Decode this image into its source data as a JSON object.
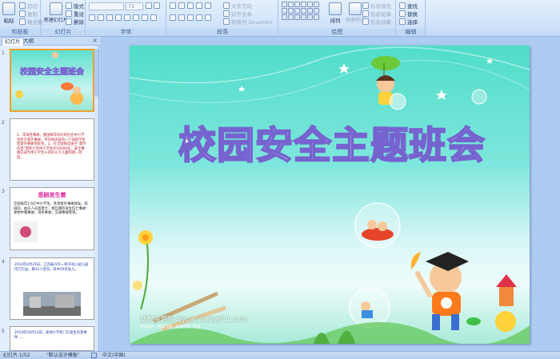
{
  "ribbon": {
    "clipboard": {
      "label": "剪贴板",
      "paste": "粘贴",
      "cut": "剪切",
      "copy": "复制",
      "format_painter": "格式刷"
    },
    "slides": {
      "label": "幻灯片",
      "new_slide": "新建幻灯片",
      "layout": "版式",
      "reset": "重设",
      "delete": "删除"
    },
    "font": {
      "label": "字体",
      "font_size": "72"
    },
    "paragraph": {
      "label": "段落",
      "text_direction": "文字方向",
      "align_text": "对齐文本",
      "smartart": "转换为 SmartArt"
    },
    "drawing": {
      "label": "绘图",
      "arrange": "排列",
      "quick_styles": "快速样式",
      "shape_fill": "形状填充",
      "shape_outline": "形状轮廓",
      "shape_effects": "形状效果"
    },
    "editing": {
      "label": "编辑",
      "find": "查找",
      "replace": "替换",
      "select": "选择"
    }
  },
  "pane": {
    "tab_slides": "幻灯片",
    "tab_outline": "大纲",
    "close": "×",
    "thumbs": [
      {
        "num": "1",
        "title": "校园安全主题班会"
      },
      {
        "num": "2",
        "text": "1、常发性事故，我国每年有约四百名中小学生死于意外事故，平均每天就有一个班的学生因意外事故而丧生。2、在全国每年由于“意外伤害”而死亡的中小学生约16000名，安全事故已成为中小学生十四岁以下儿童的第一死因。"
      },
      {
        "num": "3",
        "title": "悲剧发生着",
        "text": "全国每年1.6亿中小学生，各项意外事故频发。校园内，由于人员密度大，相互拥挤发生伤亡事故：食物中毒事故；溺水事故；交通事故等等。"
      },
      {
        "num": "4",
        "text": "2010年4月29日，江苏泰兴市一男子闯入幼儿园持刀行凶，致32人受伤，其中29名幼儿。"
      },
      {
        "num": "5",
        "text": "2010年04月23日，某地小学校门口发生伤害事件……"
      }
    ]
  },
  "slide": {
    "title": "校园安全主题班会",
    "watermark": "幼教资源网 ziyuan.baby611.com",
    "watermark_sub": "精品课件 · 教案下载 · 幼教资源 · 更多…"
  },
  "status": {
    "slide_counter": "幻灯片 1/52",
    "theme": "\"默认设计模板\"",
    "language": "中文(中国)"
  },
  "colors": {
    "title_outline": "#7663cf",
    "selection": "#f0a030"
  }
}
